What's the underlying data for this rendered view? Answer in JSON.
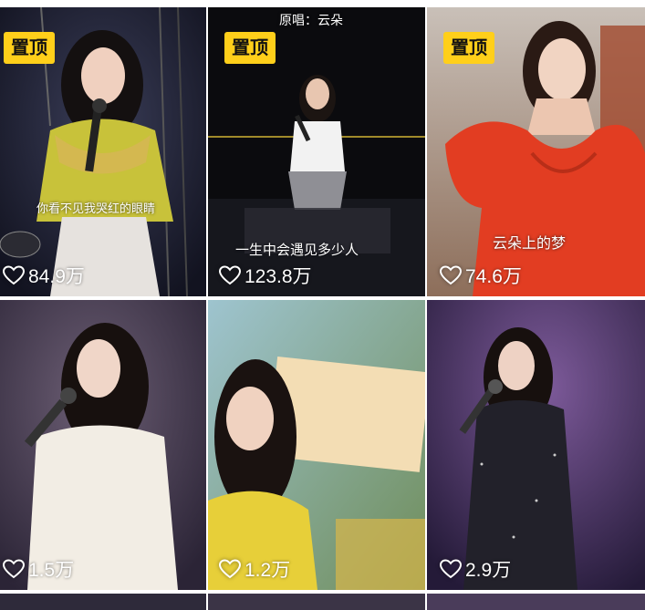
{
  "feed": {
    "pin_label": "置顶",
    "tiles": [
      {
        "likes": "84.9万",
        "pinned": true,
        "caption": "你看不见我哭红的眼睛"
      },
      {
        "likes": "123.8万",
        "pinned": true,
        "top_text": "原唱：云朵",
        "caption": "一生中会遇见多少人"
      },
      {
        "likes": "74.6万",
        "pinned": true,
        "caption": "云朵上的梦"
      },
      {
        "likes": "1.5万",
        "pinned": false
      },
      {
        "likes": "1.2万",
        "pinned": false
      },
      {
        "likes": "2.9万",
        "pinned": false
      }
    ]
  }
}
